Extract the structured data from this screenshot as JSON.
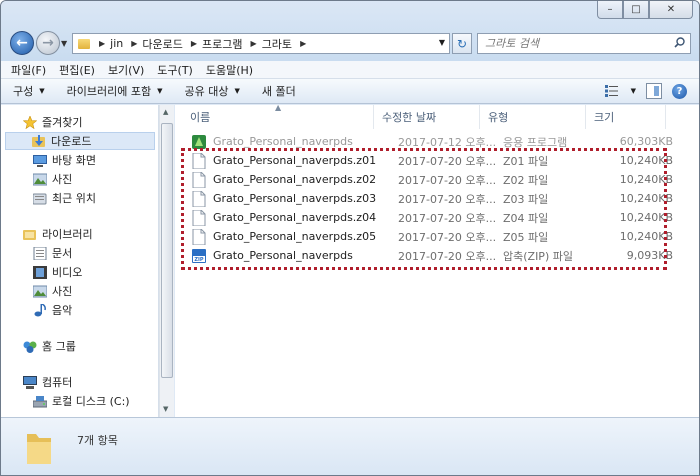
{
  "window": {
    "title": "그라토"
  },
  "address": {
    "crumbs": [
      "jin",
      "다운로드",
      "프로그램",
      "그라토"
    ]
  },
  "search": {
    "placeholder": "그라토 검색"
  },
  "menu": {
    "items": [
      "파일(F)",
      "편집(E)",
      "보기(V)",
      "도구(T)",
      "도움말(H)"
    ]
  },
  "toolbar": {
    "organize": "구성",
    "include_library": "라이브러리에 포함",
    "share": "공유 대상",
    "new_folder": "새 폴더"
  },
  "nav": {
    "favorites": "즐겨찾기",
    "downloads": "다운로드",
    "desktop": "바탕 화면",
    "pictures": "사진",
    "recent": "최근 위치",
    "libraries": "라이브러리",
    "documents": "문서",
    "videos": "비디오",
    "lib_pictures": "사진",
    "music": "음악",
    "homegroup": "홈 그룹",
    "computer": "컴퓨터",
    "local_disk": "로컬 디스크 (C:)"
  },
  "columns": {
    "name": "이름",
    "modified": "수정한 날짜",
    "type": "유형",
    "size": "크기"
  },
  "files": [
    {
      "name": "Grato_Personal_naverpds",
      "modified": "2017-07-12 오후...",
      "type": "응용 프로그램",
      "size": "60,303KB",
      "icon": "app-icon"
    },
    {
      "name": "Grato_Personal_naverpds.z01",
      "modified": "2017-07-20 오후...",
      "type": "Z01 파일",
      "size": "10,240KB",
      "icon": "file-icon"
    },
    {
      "name": "Grato_Personal_naverpds.z02",
      "modified": "2017-07-20 오후...",
      "type": "Z02 파일",
      "size": "10,240KB",
      "icon": "file-icon"
    },
    {
      "name": "Grato_Personal_naverpds.z03",
      "modified": "2017-07-20 오후...",
      "type": "Z03 파일",
      "size": "10,240KB",
      "icon": "file-icon"
    },
    {
      "name": "Grato_Personal_naverpds.z04",
      "modified": "2017-07-20 오후...",
      "type": "Z04 파일",
      "size": "10,240KB",
      "icon": "file-icon"
    },
    {
      "name": "Grato_Personal_naverpds.z05",
      "modified": "2017-07-20 오후...",
      "type": "Z05 파일",
      "size": "10,240KB",
      "icon": "file-icon"
    },
    {
      "name": "Grato_Personal_naverpds",
      "modified": "2017-07-20 오후...",
      "type": "압축(ZIP) 파일",
      "size": "9,093KB",
      "icon": "zip-icon"
    }
  ],
  "status": {
    "count": "7개 항목"
  },
  "colors": {
    "highlight": "#b01e2c",
    "selection": "#dce8f7"
  }
}
